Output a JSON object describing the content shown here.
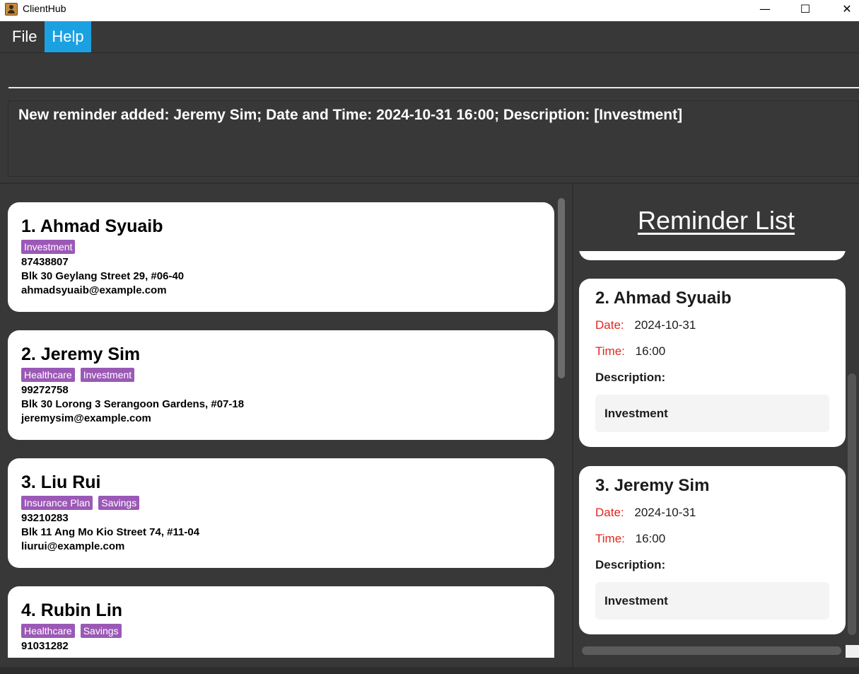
{
  "window": {
    "title": "ClientHub",
    "minimize": "—",
    "maximize": "☐",
    "close": "✕"
  },
  "menu": {
    "file": "File",
    "help": "Help"
  },
  "command": {
    "value": ""
  },
  "result": {
    "text": "New reminder added: Jeremy Sim; Date and Time: 2024-10-31 16:00; Description: [Investment]"
  },
  "persons": [
    {
      "name": "1. Ahmad Syuaib",
      "tags": [
        "Investment"
      ],
      "phone": "87438807",
      "address": "Blk 30 Geylang Street 29, #06-40",
      "email": "ahmadsyuaib@example.com"
    },
    {
      "name": "2. Jeremy Sim",
      "tags": [
        "Healthcare",
        "Investment"
      ],
      "phone": "99272758",
      "address": "Blk 30 Lorong 3 Serangoon Gardens, #07-18",
      "email": "jeremysim@example.com"
    },
    {
      "name": "3. Liu Rui",
      "tags": [
        "Insurance Plan",
        "Savings"
      ],
      "phone": "93210283",
      "address": "Blk 11 Ang Mo Kio Street 74, #11-04",
      "email": "liurui@example.com"
    },
    {
      "name": "4. Rubin Lin",
      "tags": [
        "Healthcare",
        "Savings"
      ],
      "phone": "91031282"
    }
  ],
  "reminders": {
    "heading": "Reminder List",
    "date_label": "Date:",
    "time_label": "Time:",
    "description_label": "Description:",
    "items": [
      {
        "name": "2.  Ahmad Syuaib",
        "date": "2024-10-31",
        "time": "16:00",
        "description": "Investment"
      },
      {
        "name": "3.  Jeremy Sim",
        "date": "2024-10-31",
        "time": "16:00",
        "description": "Investment"
      }
    ]
  }
}
